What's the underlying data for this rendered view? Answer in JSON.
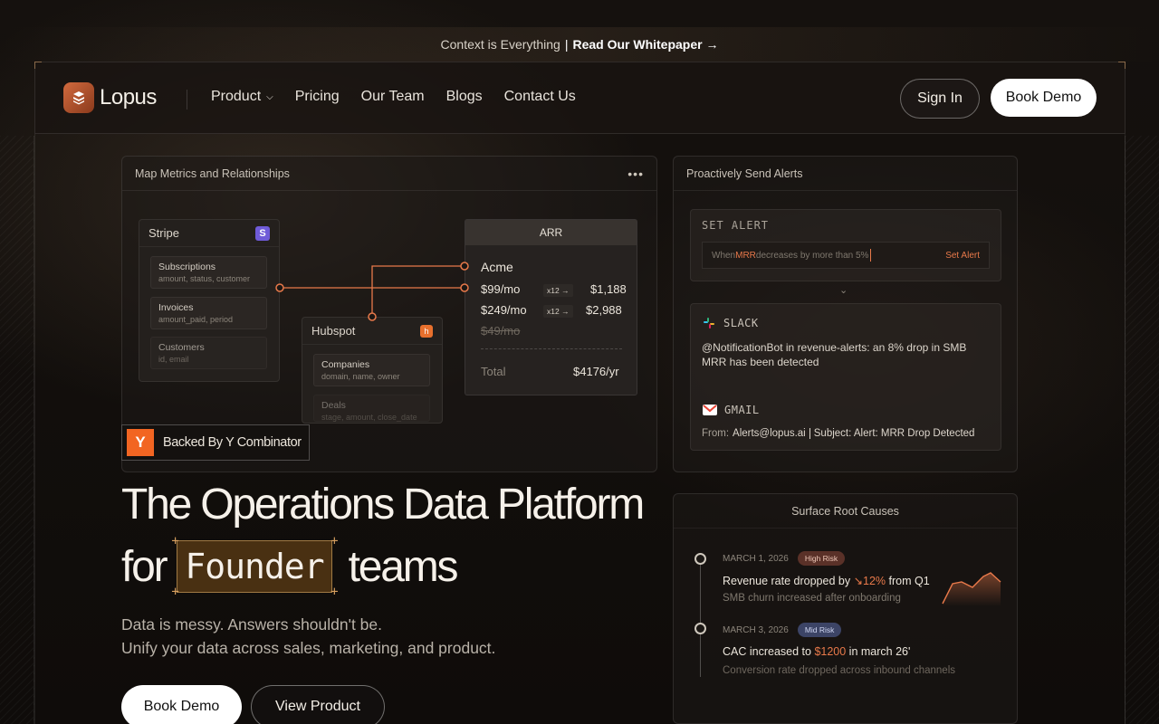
{
  "announcement": {
    "text": "Context is Everything",
    "separator": "|",
    "cta": "Read Our Whitepaper →"
  },
  "nav": {
    "brand": "Lopus",
    "links": [
      "Product",
      "Pricing",
      "Our Team",
      "Blogs",
      "Contact Us"
    ],
    "sign_in": "Sign In",
    "book_demo": "Book Demo"
  },
  "map_panel": {
    "title": "Map Metrics and Relationships",
    "menu": "•••",
    "stripe": {
      "title": "Stripe",
      "badge": "S",
      "fields": [
        {
          "name": "Subscriptions",
          "sub": "amount, status, customer"
        },
        {
          "name": "Invoices",
          "sub": "amount_paid, period"
        },
        {
          "name": "Customers",
          "sub": "id, email"
        }
      ]
    },
    "hubspot": {
      "title": "Hubspot",
      "badge": "h",
      "fields": [
        {
          "name": "Companies",
          "sub": "domain, name, owner"
        },
        {
          "name": "Deals",
          "sub": "stage, amount, close_date"
        }
      ]
    },
    "arr": {
      "title": "ARR",
      "company": "Acme",
      "rows": [
        {
          "price": "$99/mo",
          "mult": "x12 →",
          "total": "$1,188"
        },
        {
          "price": "$249/mo",
          "mult": "x12 →",
          "total": "$2,988"
        }
      ],
      "struck": "$49/mo",
      "total_label": "Total",
      "total_value": "$4176/yr"
    }
  },
  "alerts_panel": {
    "title": "Proactively Send Alerts",
    "set_alert_label": "SET ALERT",
    "condition_prefix": "When ",
    "condition_metric": "MRR",
    "condition_suffix": " decreases by more than 5%",
    "set_alert_button": "Set Alert",
    "slack": {
      "label": "SLACK",
      "message": "@NotificationBot in revenue-alerts: an 8% drop in SMB MRR has been detected"
    },
    "gmail": {
      "label": "GMAIL",
      "from_label": "From:",
      "from": "Alerts@lopus.ai",
      "subject": "Subject: Alert: MRR Drop Detected"
    }
  },
  "root_panel": {
    "title": "Surface Root Causes",
    "events": [
      {
        "date": "MARCH 1, 2026",
        "risk": "High Risk",
        "headline_pre": "Revenue rate dropped by ",
        "headline_value": "12%",
        "headline_post": " from Q1",
        "detail": "SMB churn increased after onboarding"
      },
      {
        "date": "MARCH 3, 2026",
        "risk": "Mid Risk",
        "headline_pre": "CAC increased to ",
        "headline_value": "$1200",
        "headline_post": " in march 26'",
        "detail": "Conversion rate dropped across inbound channels"
      }
    ]
  },
  "hero": {
    "backed": "Backed By Y Combinator",
    "yc_logo": "Y",
    "title_line1": "The Operations Data Platform",
    "title_for": "for",
    "title_highlight": "Founder",
    "title_end": "teams",
    "subtitle_1": "Data is messy. Answers shouldn't be.",
    "subtitle_2": "Unify your data across sales, marketing, and product.",
    "cta_primary": "Book Demo",
    "cta_secondary": "View Product"
  },
  "colors": {
    "accent": "#e8794a",
    "background": "#0d0b09"
  }
}
